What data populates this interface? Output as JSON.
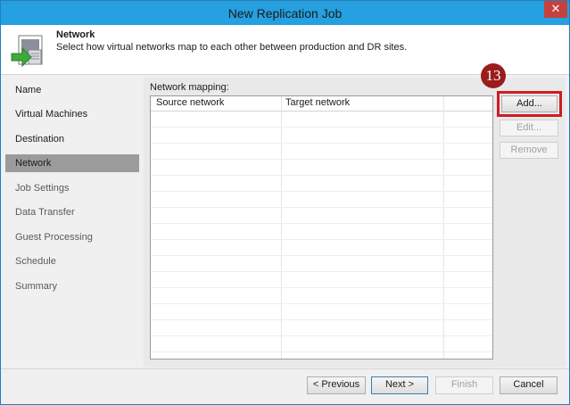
{
  "window": {
    "title": "New Replication Job",
    "close_glyph": "✕"
  },
  "header": {
    "title": "Network",
    "description": "Select how virtual networks map to each other between production and DR sites.",
    "icon": "network-wizard-icon"
  },
  "sidebar": {
    "items": [
      {
        "label": "Name",
        "state": "done"
      },
      {
        "label": "Virtual Machines",
        "state": "done"
      },
      {
        "label": "Destination",
        "state": "done"
      },
      {
        "label": "Network",
        "state": "active"
      },
      {
        "label": "Job Settings",
        "state": "pending"
      },
      {
        "label": "Data Transfer",
        "state": "pending"
      },
      {
        "label": "Guest Processing",
        "state": "pending"
      },
      {
        "label": "Schedule",
        "state": "pending"
      },
      {
        "label": "Summary",
        "state": "pending"
      }
    ]
  },
  "mapping": {
    "label": "Network mapping:",
    "columns": [
      "Source network",
      "Target network"
    ],
    "rows": []
  },
  "side_buttons": {
    "add": "Add...",
    "edit": "Edit...",
    "remove": "Remove"
  },
  "annotation": {
    "step_number": "13",
    "highlight_color": "#d01c24"
  },
  "footer": {
    "previous": "< Previous",
    "next": "Next >",
    "finish": "Finish",
    "cancel": "Cancel"
  },
  "colors": {
    "titlebar": "#25a0e0",
    "active_nav": "#9b9b9b",
    "badge": "#9b1c1c"
  }
}
